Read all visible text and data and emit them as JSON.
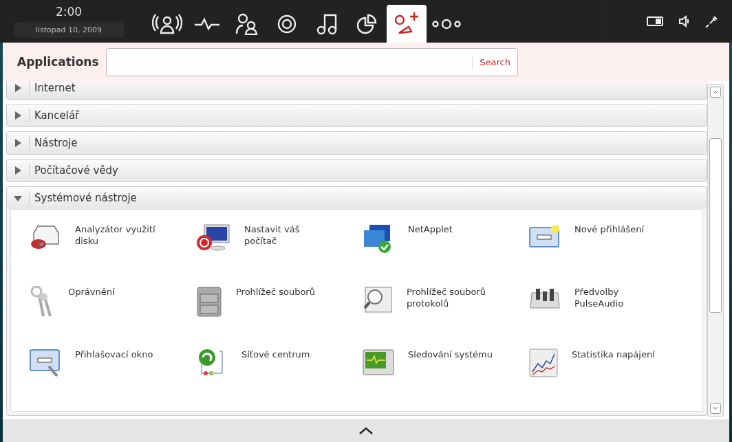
{
  "clock": {
    "time": "2:00",
    "date": "listopad 10, 2009"
  },
  "tabs": [
    {
      "selected": false
    },
    {
      "selected": false
    },
    {
      "selected": false
    },
    {
      "selected": false
    },
    {
      "selected": false
    },
    {
      "selected": false
    },
    {
      "selected": true
    },
    {
      "selected": false
    }
  ],
  "header": {
    "title": "Applications",
    "search_button": "Search"
  },
  "categories": [
    {
      "label": "Internet",
      "expanded": false
    },
    {
      "label": "Kancelář",
      "expanded": false
    },
    {
      "label": "Nástroje",
      "expanded": false
    },
    {
      "label": "Počítačové vědy",
      "expanded": false
    },
    {
      "label": "Systémové nástroje",
      "expanded": true,
      "apps": [
        "Analyzátor využití disku",
        "Nastavit váš počítač",
        "NetApplet",
        "Nové přihlášení",
        "Oprávnění",
        "Prohlížeč souborů",
        "Prohlížeč souborů protokolů",
        "Předvolby PulseAudio",
        "Přihlašovací okno",
        "Síťové centrum",
        "Sledování systému",
        "Statistika napájení"
      ]
    }
  ]
}
